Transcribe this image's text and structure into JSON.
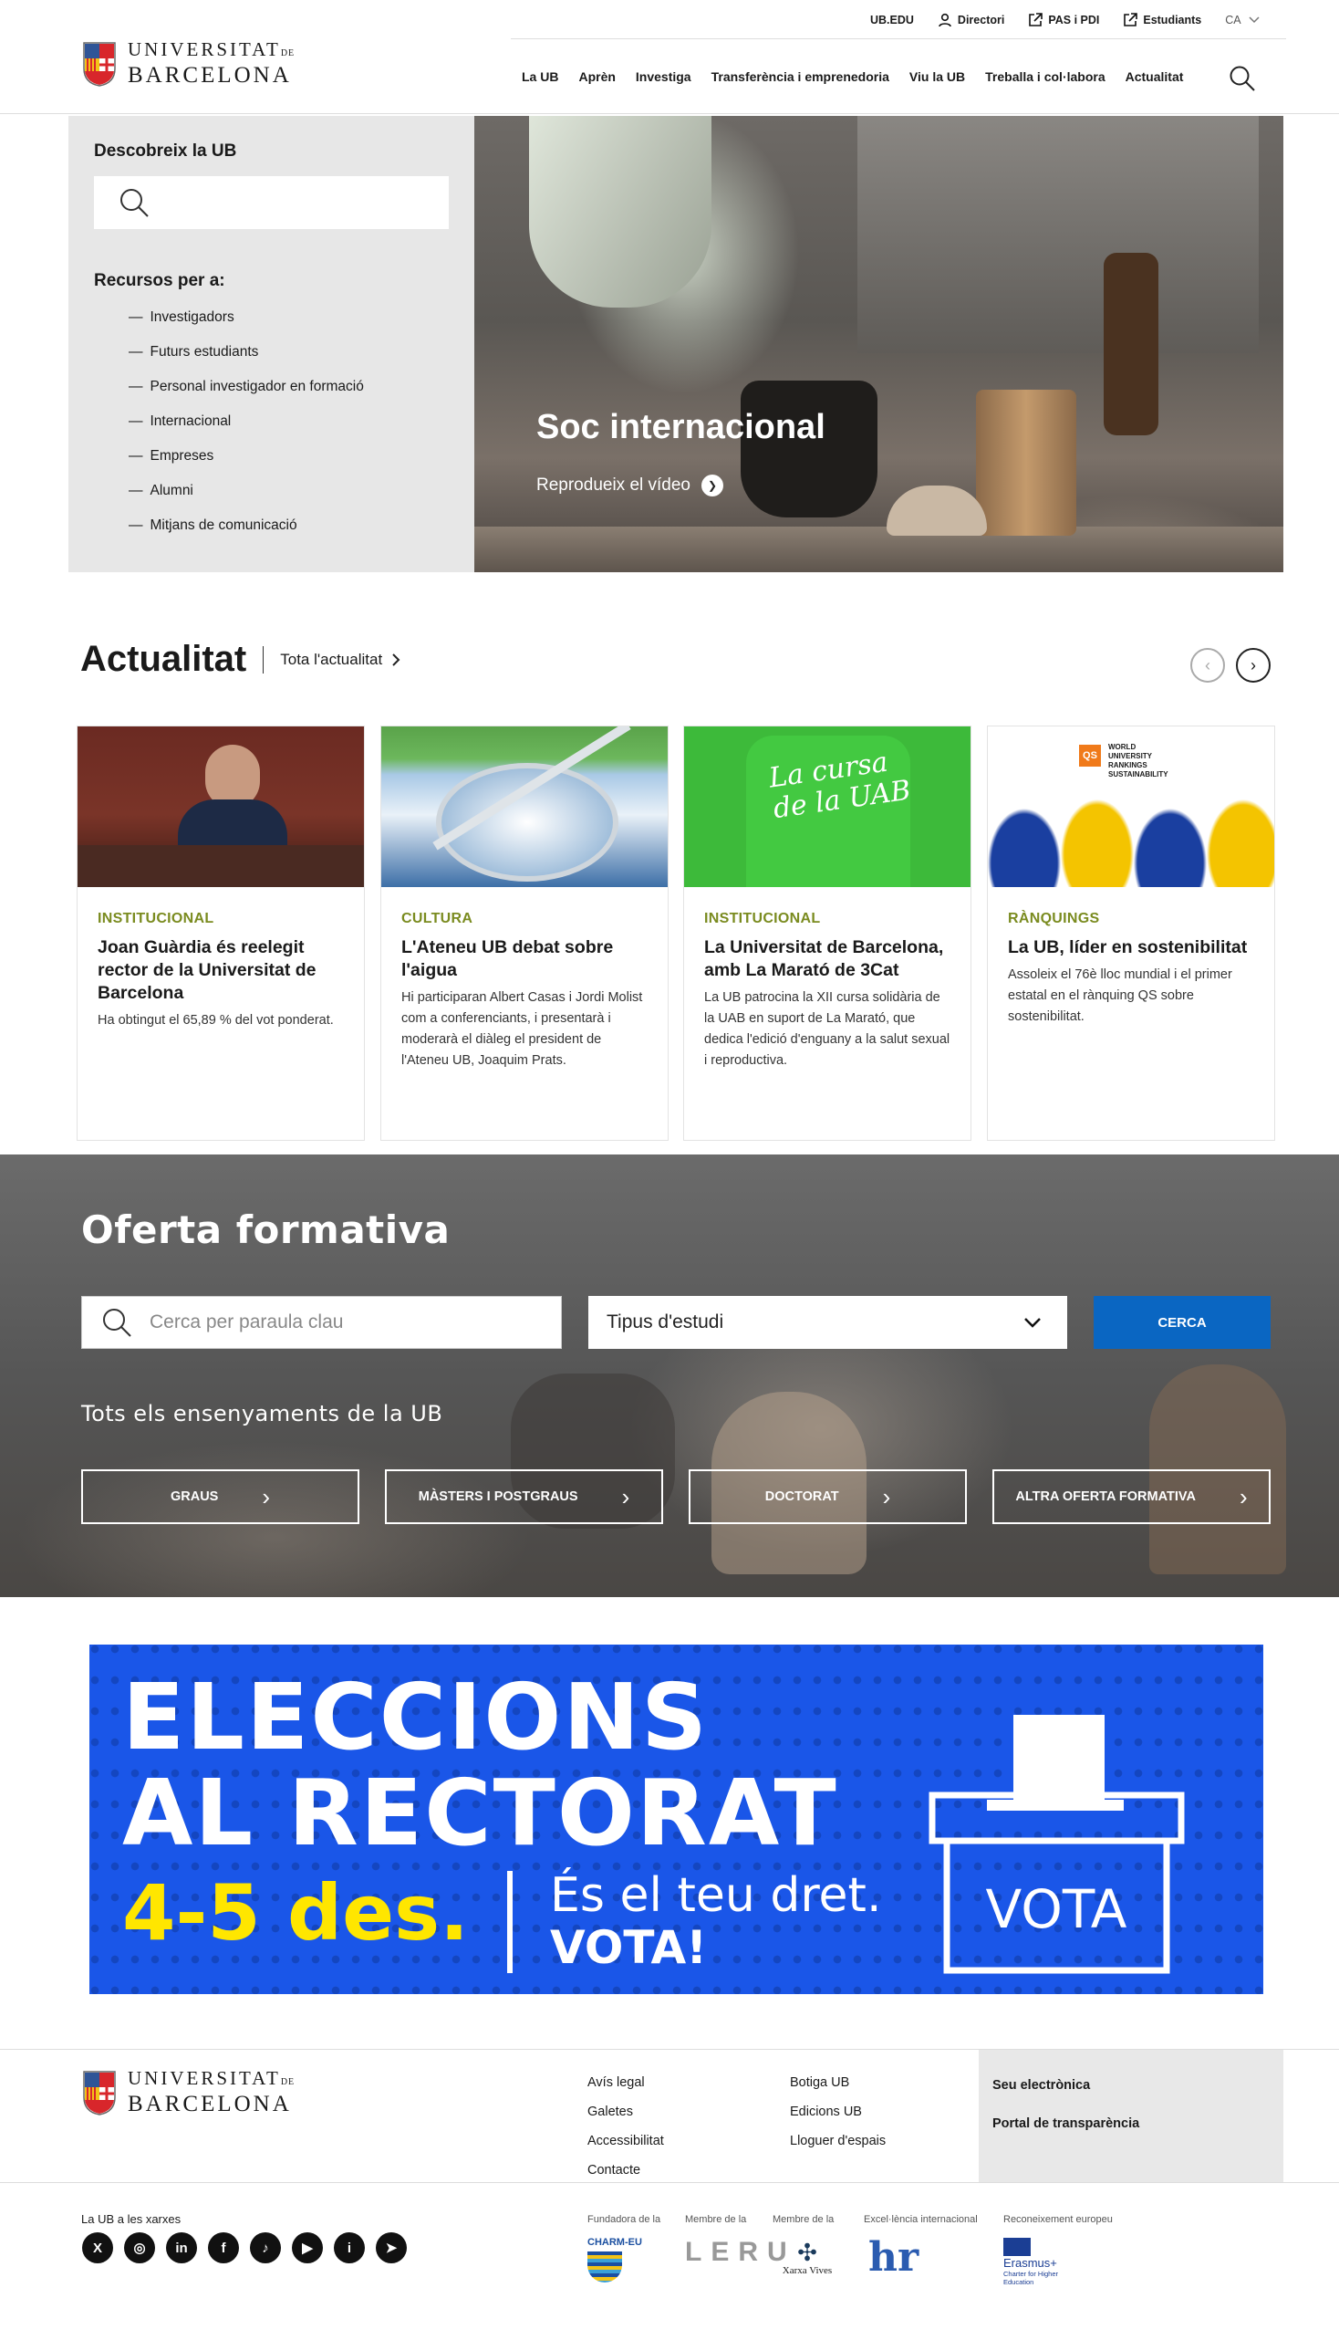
{
  "header": {
    "logo": {
      "line1": "UNIVERSITAT",
      "line1_small": "DE",
      "line2": "BARCELONA"
    },
    "util": [
      {
        "label": "UB.EDU",
        "icon": ""
      },
      {
        "label": "Directori",
        "icon": "person-icon"
      },
      {
        "label": "PAS i PDI",
        "icon": "external-link-icon"
      },
      {
        "label": "Estudiants",
        "icon": "external-link-icon"
      }
    ],
    "lang": "CA",
    "nav": [
      "La UB",
      "Aprèn",
      "Investiga",
      "Transferència i emprenedoria",
      "Viu la UB",
      "Treballa i col·labora",
      "Actualitat"
    ]
  },
  "discover": {
    "title": "Descobreix la UB",
    "resources_title": "Recursos per a:",
    "items": [
      "Investigadors",
      "Futurs estudiants",
      "Personal investigador en formació",
      "Internacional",
      "Empreses",
      "Alumni",
      "Mitjans de comunicació"
    ]
  },
  "hero": {
    "title": "Soc internacional",
    "video": "Reprodueix el vídeo"
  },
  "news": {
    "title": "Actualitat",
    "all": "Tota l'actualitat",
    "cards": [
      {
        "category": "INSTITUCIONAL",
        "title": "Joan Guàrdia és reelegit rector de la Universitat de Barcelona",
        "desc": "Ha obtingut el 65,89 % del vot ponderat."
      },
      {
        "category": "CULTURA",
        "title": "L'Ateneu UB debat sobre l'aigua",
        "desc": "Hi participaran Albert Casas i Jordi Molist com a conferenciants, i presentarà i moderarà el diàleg el president de l'Ateneu UB, Joaquim Prats."
      },
      {
        "category": "INSTITUCIONAL",
        "title": "La Universitat de Barcelona, amb La Marató de 3Cat",
        "desc": "La UB patrocina la XII cursa solidària de la UAB en suport de La Marató, que dedica l'edició d'enguany a la salut sexual i reproductiva."
      },
      {
        "category": "RÀNQUINGS",
        "title": "La UB, líder en sostenibilitat",
        "desc": "Assoleix el 76è lloc mundial i el primer estatal en el rànquing QS sobre sostenibilitat."
      }
    ],
    "tshirt_text": [
      "La cursa",
      "de la UAB"
    ],
    "qs_text": [
      "WORLD",
      "UNIVERSITY",
      "RANKINGS",
      "SUSTAINABILITY"
    ]
  },
  "oferta": {
    "title": "Oferta formativa",
    "search_placeholder": "Cerca per paraula clau",
    "select": "Tipus d'estudi",
    "search_btn": "CERCA",
    "subtitle": "Tots els ensenyaments de la UB",
    "buttons": [
      "GRAUS",
      "MÀSTERS I POSTGRAUS",
      "DOCTORAT",
      "ALTRA OFERTA FORMATIVA"
    ]
  },
  "banner": {
    "line1": "ELECCIONS",
    "line2": "AL RECTORAT",
    "date": "4-5 des.",
    "right1": "És el teu dret.",
    "right2": "VOTA!",
    "box": "VOTA"
  },
  "footer": {
    "col1": [
      "Avís legal",
      "Galetes",
      "Accessibilitat",
      "Contacte"
    ],
    "col2": [
      "Botiga UB",
      "Edicions UB",
      "Lloguer d'espais"
    ],
    "col3": [
      "Seu electrònica",
      "Portal de transparència"
    ],
    "social_title": "La UB a les xarxes",
    "social": [
      "X",
      "◎",
      "in",
      "f",
      "♪",
      "▶",
      "i",
      "➤"
    ],
    "badges": [
      {
        "label": "Fundadora de la",
        "name": "CHARM-EU"
      },
      {
        "label": "Membre de la",
        "name": "LERU"
      },
      {
        "label": "Membre de la",
        "name": "Xarxa Vives"
      },
      {
        "label": "Excel·lència internacional",
        "name": "hr"
      },
      {
        "label": "Reconeixement europeu",
        "name": "Erasmus+"
      }
    ],
    "erasmus_sub": "Charter for Higher Education"
  }
}
